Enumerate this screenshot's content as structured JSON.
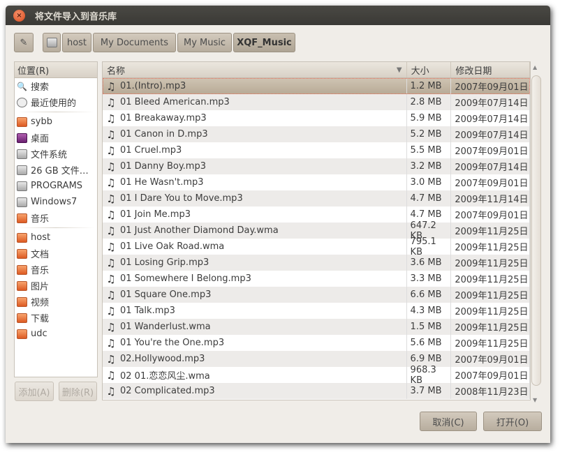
{
  "title": "将文件导入到音乐库",
  "path": [
    "host",
    "My Documents",
    "My Music",
    "XQF_Music"
  ],
  "sidebar": {
    "header": "位置(R)",
    "group1": [
      {
        "label": "搜索",
        "icon": "search-icon"
      },
      {
        "label": "最近使用的",
        "icon": "clock-icon"
      }
    ],
    "group2": [
      {
        "label": "sybb",
        "icon": "home-folder-icon"
      },
      {
        "label": "桌面",
        "icon": "desktop-icon"
      },
      {
        "label": "文件系统",
        "icon": "drive-icon"
      },
      {
        "label": "26 GB 文件…",
        "icon": "drive-icon"
      },
      {
        "label": "PROGRAMS",
        "icon": "drive-icon"
      },
      {
        "label": "Windows7",
        "icon": "drive-icon"
      },
      {
        "label": "音乐",
        "icon": "music-folder-icon"
      }
    ],
    "group3": [
      {
        "label": "host",
        "icon": "folder-icon"
      },
      {
        "label": "文档",
        "icon": "documents-folder-icon"
      },
      {
        "label": "音乐",
        "icon": "music-folder-icon"
      },
      {
        "label": "图片",
        "icon": "pictures-folder-icon"
      },
      {
        "label": "视频",
        "icon": "videos-folder-icon"
      },
      {
        "label": "下载",
        "icon": "downloads-folder-icon"
      },
      {
        "label": "udc",
        "icon": "folder-icon"
      }
    ],
    "add": "添加(A)",
    "remove": "删除(R)"
  },
  "columns": {
    "name": "名称",
    "size": "大小",
    "date": "修改日期"
  },
  "files": [
    [
      "01.(Intro).mp3",
      "1.2 MB",
      "2007年09月01日"
    ],
    [
      "01 Bleed American.mp3",
      "2.8 MB",
      "2009年07月14日"
    ],
    [
      "01 Breakaway.mp3",
      "5.9 MB",
      "2009年07月14日"
    ],
    [
      "01 Canon in D.mp3",
      "5.2 MB",
      "2009年07月14日"
    ],
    [
      "01 Cruel.mp3",
      "5.5 MB",
      "2007年09月01日"
    ],
    [
      "01 Danny Boy.mp3",
      "3.2 MB",
      "2009年07月14日"
    ],
    [
      "01 He Wasn't.mp3",
      "3.0 MB",
      "2007年09月01日"
    ],
    [
      "01 I Dare You to Move.mp3",
      "4.7 MB",
      "2009年11月14日"
    ],
    [
      "01 Join Me.mp3",
      "4.7 MB",
      "2007年09月01日"
    ],
    [
      "01 Just Another Diamond Day.wma",
      "647.2 KB",
      "2009年11月25日"
    ],
    [
      "01 Live Oak Road.wma",
      "795.1 KB",
      "2009年11月25日"
    ],
    [
      "01 Losing Grip.mp3",
      "3.6 MB",
      "2009年11月25日"
    ],
    [
      "01 Somewhere I Belong.mp3",
      "3.3 MB",
      "2009年11月25日"
    ],
    [
      "01 Square One.mp3",
      "6.6 MB",
      "2009年11月25日"
    ],
    [
      "01 Talk.mp3",
      "4.3 MB",
      "2009年11月25日"
    ],
    [
      "01 Wanderlust.wma",
      "1.5 MB",
      "2009年11月25日"
    ],
    [
      "01 You're the One.mp3",
      "5.6 MB",
      "2009年11月25日"
    ],
    [
      "02.Hollywood.mp3",
      "6.9 MB",
      "2007年09月01日"
    ],
    [
      "02 01.恋恋风尘.wma",
      "968.3 KB",
      "2007年09月01日"
    ],
    [
      "02 Complicated.mp3",
      "3.7 MB",
      "2008年11月23日"
    ]
  ],
  "buttons": {
    "cancel": "取消(C)",
    "open": "打开(O)"
  }
}
